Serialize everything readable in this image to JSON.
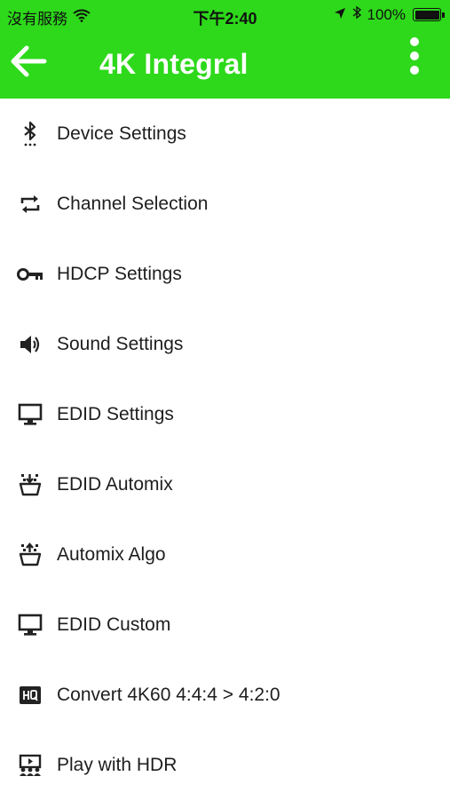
{
  "status_bar": {
    "carrier": "沒有服務",
    "time": "下午2:40",
    "battery": "100%"
  },
  "header": {
    "title": "4K Integral",
    "accent_color": "#2dd91a"
  },
  "menu_items": [
    {
      "label": "Device Settings",
      "icon": "bluetooth-icon"
    },
    {
      "label": "Channel Selection",
      "icon": "repeat-icon"
    },
    {
      "label": "HDCP Settings",
      "icon": "key-icon"
    },
    {
      "label": "Sound Settings",
      "icon": "speaker-icon"
    },
    {
      "label": "EDID Settings",
      "icon": "monitor-icon"
    },
    {
      "label": "EDID Automix",
      "icon": "bowl-down-icon"
    },
    {
      "label": "Automix Algo",
      "icon": "bowl-up-icon"
    },
    {
      "label": "EDID Custom",
      "icon": "monitor-icon"
    },
    {
      "label": "Convert 4K60 4:4:4 > 4:2:0",
      "icon": "hq-icon"
    },
    {
      "label": "Play with HDR",
      "icon": "theater-icon"
    }
  ]
}
